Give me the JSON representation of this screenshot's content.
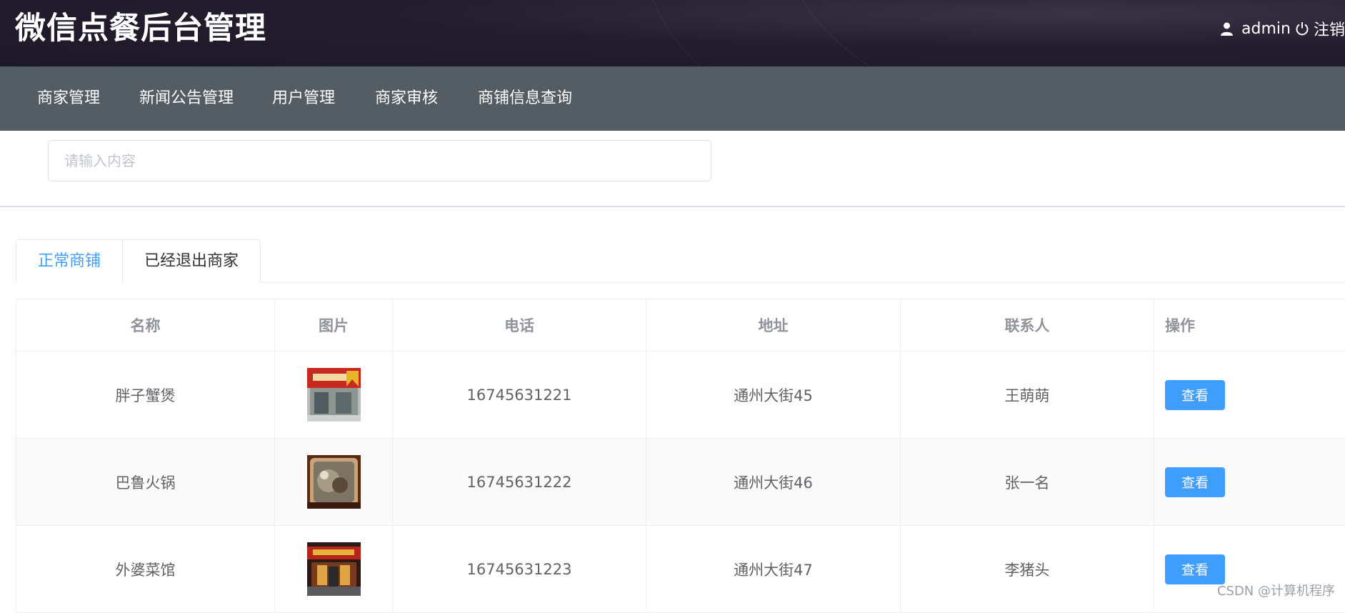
{
  "header": {
    "title": "微信点餐后台管理",
    "user_name": "admin",
    "logout_label": "注销"
  },
  "nav": {
    "items": [
      {
        "label": "商家管理"
      },
      {
        "label": "新闻公告管理"
      },
      {
        "label": "用户管理"
      },
      {
        "label": "商家审核"
      },
      {
        "label": "商铺信息查询"
      }
    ]
  },
  "search": {
    "placeholder": "请输入内容",
    "value": ""
  },
  "tabs": [
    {
      "label": "正常商铺",
      "active": true
    },
    {
      "label": "已经退出商家",
      "active": false
    }
  ],
  "table": {
    "columns": [
      "名称",
      "图片",
      "电话",
      "地址",
      "联系人",
      "操作"
    ],
    "rows": [
      {
        "name": "胖子蟹煲",
        "phone": "16745631221",
        "address": "通州大街45",
        "contact": "王萌萌",
        "action": "查看"
      },
      {
        "name": "巴鲁火锅",
        "phone": "16745631222",
        "address": "通州大街46",
        "contact": "张一名",
        "action": "查看"
      },
      {
        "name": "外婆菜馆",
        "phone": "16745631223",
        "address": "通州大街47",
        "contact": "李猪头",
        "action": "查看"
      }
    ]
  },
  "watermark": "CSDN @计算机程序",
  "colors": {
    "header_bg": "#241d2f",
    "nav_bg": "#545c64",
    "accent": "#409eff"
  }
}
